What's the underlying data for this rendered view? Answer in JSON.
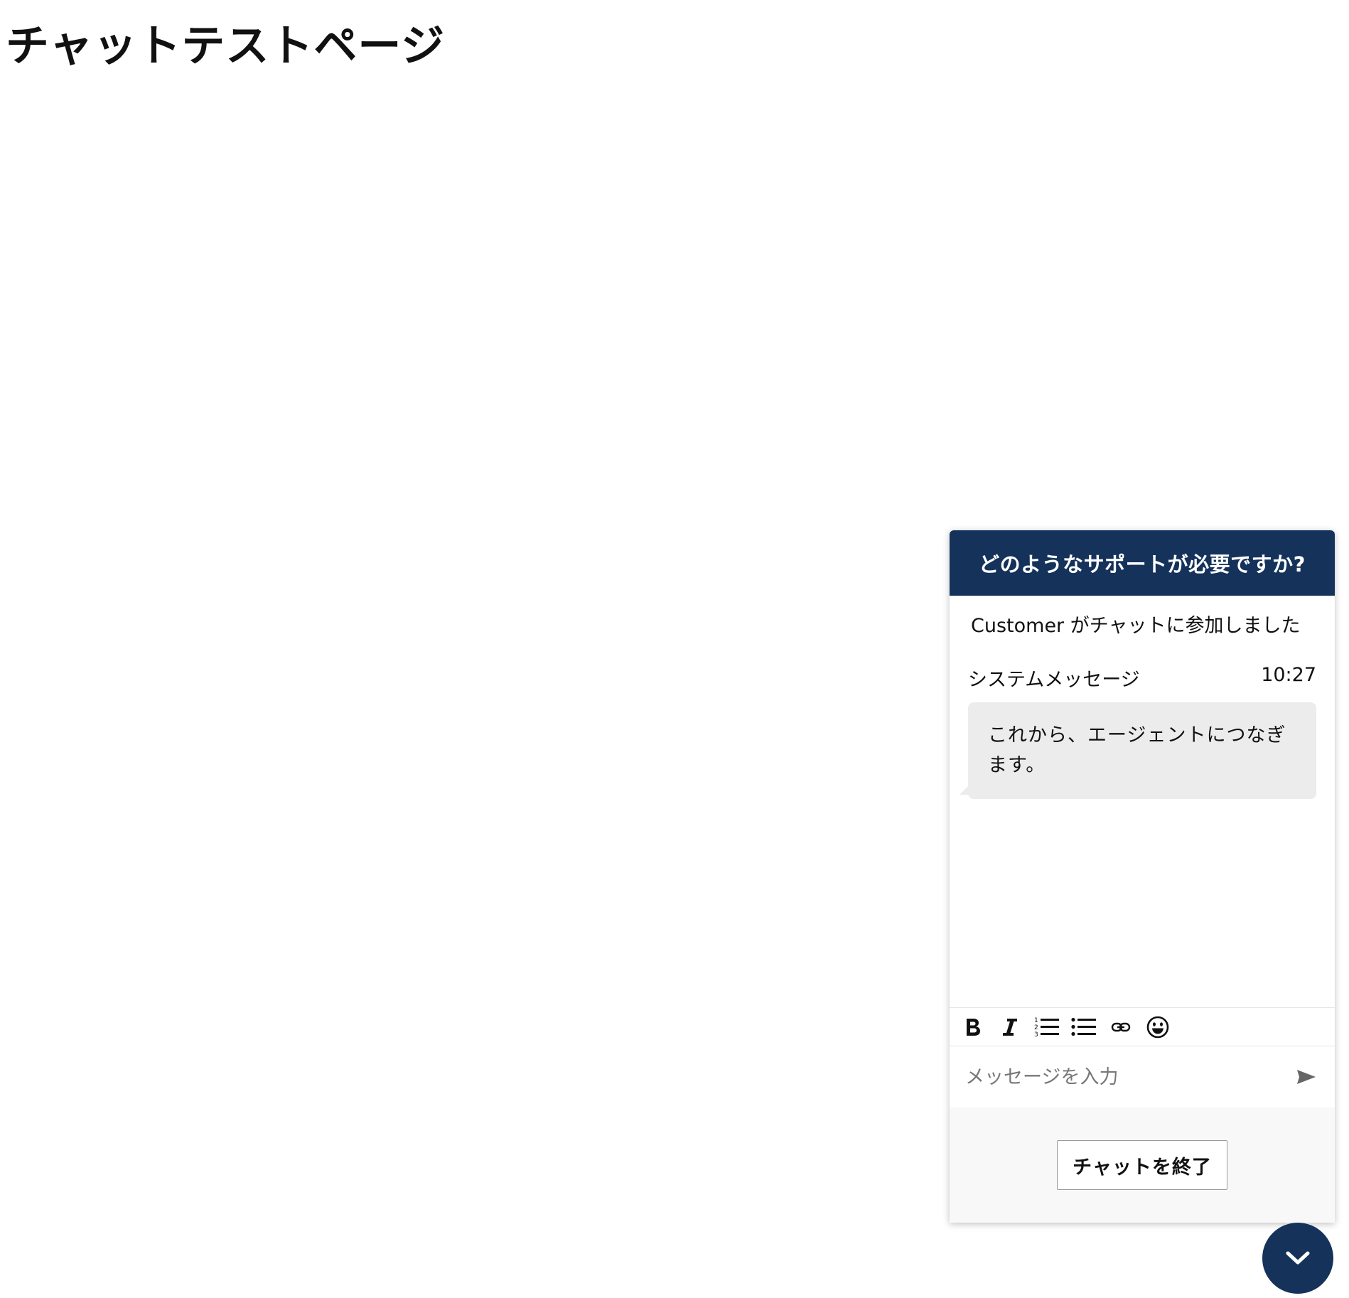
{
  "page": {
    "title": "チャットテストページ"
  },
  "chat": {
    "header_title": "どのようなサポートが必要ですか?",
    "join_notice": "Customer がチャットに参加しました",
    "message": {
      "sender": "システムメッセージ",
      "time": "10:27",
      "text": "これから、エージェントにつなぎます。"
    },
    "toolbar": {
      "icons": [
        "bold-icon",
        "italic-icon",
        "numbered-list-icon",
        "bulleted-list-icon",
        "link-icon",
        "emoji-icon"
      ]
    },
    "input": {
      "placeholder": "メッセージを入力",
      "value": ""
    },
    "end_chat_label": "チャットを終了",
    "colors": {
      "header_bg": "#14325a",
      "bubble_bg": "#ececec",
      "footer_bg": "#f8f8f8"
    }
  }
}
